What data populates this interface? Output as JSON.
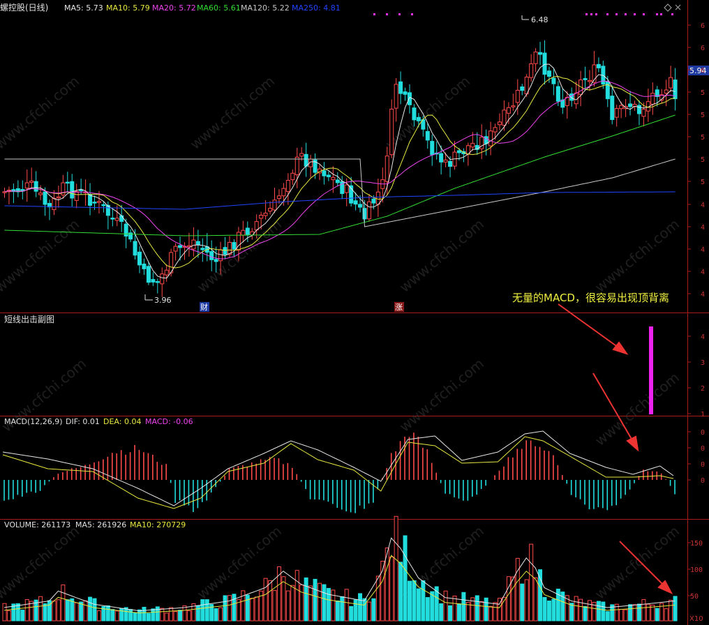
{
  "colors": {
    "up": "#ff4a4a",
    "down": "#22dddd",
    "ma5": "#e6e6e6",
    "ma10": "#e8e840",
    "ma20": "#ee44ee",
    "ma60": "#33dd33",
    "ma120": "#c8c8c8",
    "ma250": "#2244ff",
    "frame": "#aa1a1a",
    "marker": "#ee33ee",
    "annotation": "#f0f040"
  },
  "header": {
    "name": "螺控股(日线)",
    "ma5": "MA5: 5.73",
    "ma10": "MA10: 5.79",
    "ma20": "MA20: 5.72",
    "ma60": "MA60: 5.61",
    "ma120": "MA120: 5.22",
    "ma250": "MA250: 4.81"
  },
  "price_panel": {
    "current_price": "5.94",
    "high_label": "6.48",
    "low_label": "3.96",
    "tag_cai": "财",
    "tag_zhang": "涨",
    "annotation": "无量的MACD，很容易出现顶背离",
    "axis_ticks": [
      "6",
      "6",
      "6",
      "5",
      "5",
      "5",
      "5",
      "5",
      "4",
      "4",
      "4",
      "4",
      "4"
    ]
  },
  "sub_panel": {
    "title": "短线出击副图",
    "axis_ticks": [
      "4",
      "3",
      "2",
      "1"
    ]
  },
  "macd_panel": {
    "params": "MACD(12,26,9)",
    "dif": "DIF: 0.01",
    "dea": "DEA: 0.04",
    "macd": "MACD: -0.06",
    "axis_ticks": [
      "0",
      "0",
      "0",
      "0"
    ]
  },
  "volume_panel": {
    "title": "VOLUME: 261173",
    "ma5": "MA5: 261926",
    "ma10": "MA10: 270729",
    "axis_ticks": [
      "150",
      "100",
      "50"
    ],
    "unit": "X10"
  },
  "watermark": "www.cfchi.com",
  "chart_data": {
    "type": "candlestick",
    "bars": 150,
    "price_range": [
      3.96,
      6.48
    ],
    "current_price": 5.94,
    "moving_averages": {
      "MA5": 5.73,
      "MA10": 5.79,
      "MA20": 5.72,
      "MA60": 5.61,
      "MA120": 5.22,
      "MA250": 4.81
    },
    "macd": {
      "DIF": 0.01,
      "DEA": 0.04,
      "MACD": -0.06
    },
    "volume": {
      "VOLUME": 261173,
      "MA5": 261926,
      "MA10": 270729
    }
  }
}
